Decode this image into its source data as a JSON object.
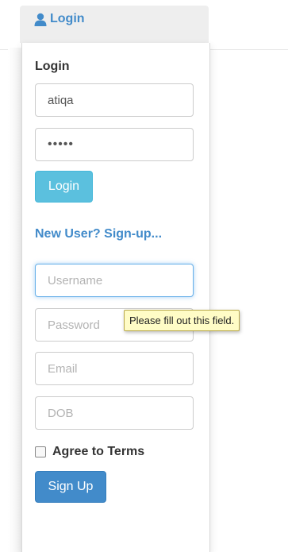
{
  "nav": {
    "login_tab_label": "Login",
    "user_icon": "user-icon"
  },
  "login_form": {
    "title": "Login",
    "username_value": "atiqa",
    "password_value": "•••••",
    "submit_label": "Login"
  },
  "signup_link": "New User? Sign-up...",
  "signup_form": {
    "username_placeholder": "Username",
    "password_placeholder": "Password",
    "email_placeholder": "Email",
    "dob_placeholder": "DOB",
    "terms_label": "Agree to Terms",
    "terms_checked": false,
    "submit_label": "Sign Up"
  },
  "validation_tooltip": "Please fill out this field.",
  "colors": {
    "link": "#428bca",
    "login_button": "#5bc0de",
    "signup_button": "#428bca",
    "tooltip_bg": "#fffcc6",
    "focus_border": "#66afe9"
  }
}
